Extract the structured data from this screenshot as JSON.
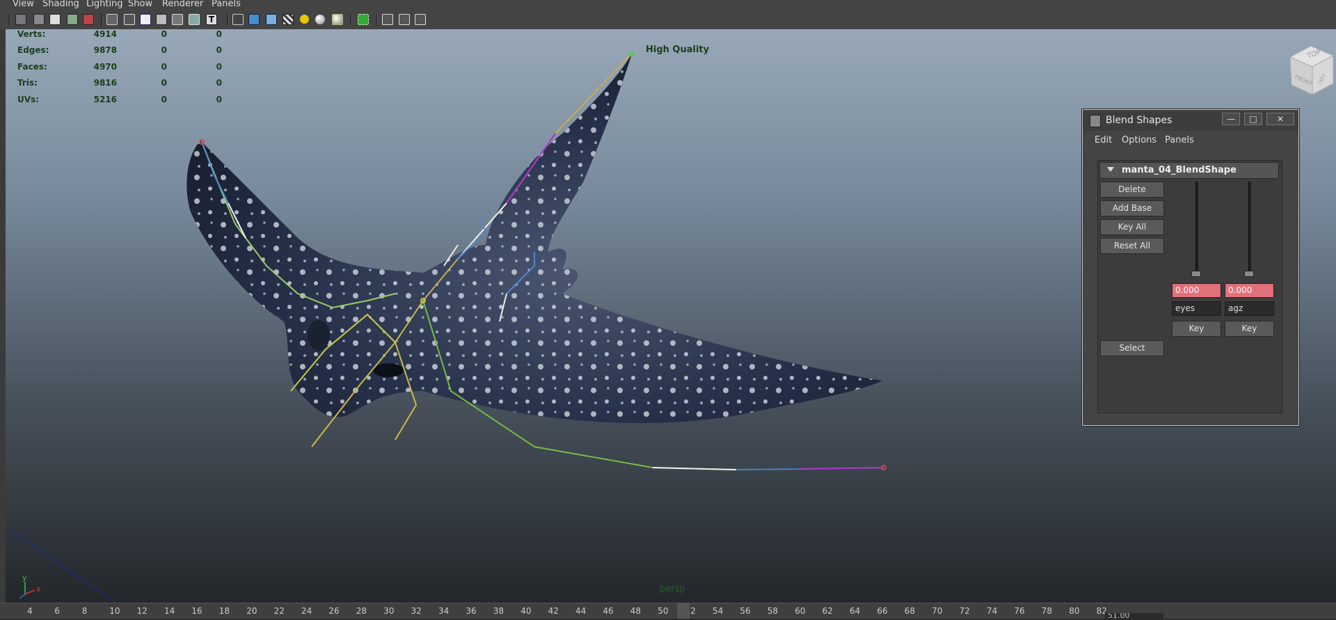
{
  "menu": [
    "View",
    "Shading",
    "Lighting",
    "Show",
    "Renderer",
    "Panels"
  ],
  "toolbar_icons": [
    "camera-icon",
    "camera-attr-icon",
    "bookmark-icon",
    "image-plane-icon",
    "2d-pan-icon",
    "wireframe-icon",
    "smooth-shade-icon",
    "default-material-icon",
    "xray-icon",
    "texture-icon",
    "light-icon",
    "text-icon",
    "isolate-icon",
    "shaded-box-icon",
    "textured-box-icon",
    "checker-icon",
    "sphere-icon",
    "lit-sphere-icon",
    "select-highlight-icon",
    "cube-icon",
    "resize-icon",
    "share-icon"
  ],
  "hud": {
    "rows": [
      {
        "label": "Verts:",
        "values": [
          "4914",
          "0",
          "0"
        ]
      },
      {
        "label": "Edges:",
        "values": [
          "9878",
          "0",
          "0"
        ]
      },
      {
        "label": "Faces:",
        "values": [
          "4970",
          "0",
          "0"
        ]
      },
      {
        "label": "Tris:",
        "values": [
          "9816",
          "0",
          "0"
        ]
      },
      {
        "label": "UVs:",
        "values": [
          "5216",
          "0",
          "0"
        ]
      }
    ],
    "quality": "High Quality",
    "camera": "persp"
  },
  "viewcube": {
    "top": "TOP",
    "front": "FRONT",
    "side": "LEFT"
  },
  "axis": {
    "y": "y",
    "x": "x"
  },
  "blend_shapes": {
    "title": "Blend Shapes",
    "menu": [
      "Edit",
      "Options",
      "Panels"
    ],
    "node_name": "manta_04_BlendShape",
    "buttons": {
      "delete": "Delete",
      "add_base": "Add Base",
      "key_all": "Key All",
      "reset_all": "Reset All",
      "select": "Select"
    },
    "targets": [
      {
        "name": "eyes",
        "value": "0.000",
        "key_label": "Key",
        "weight": 0
      },
      {
        "name": "agz",
        "value": "0.000",
        "key_label": "Key",
        "weight": 0
      }
    ],
    "window_buttons": {
      "minimize": "—",
      "maximize": "□",
      "close": "✕"
    }
  },
  "timeline": {
    "ticks": [
      "4",
      "6",
      "8",
      "10",
      "12",
      "14",
      "16",
      "18",
      "20",
      "22",
      "24",
      "26",
      "28",
      "30",
      "32",
      "34",
      "36",
      "38",
      "40",
      "42",
      "44",
      "46",
      "48",
      "50",
      "52",
      "54",
      "56",
      "58",
      "60",
      "62",
      "64",
      "66",
      "68",
      "70",
      "72",
      "74",
      "76",
      "78",
      "80",
      "82"
    ],
    "current_time": "51.00"
  },
  "colors": {
    "menu_bg": "#444444",
    "hud_text": "#1b3d1b",
    "value_field": "#e2707a",
    "manta_skin": "#1f2a3d"
  }
}
